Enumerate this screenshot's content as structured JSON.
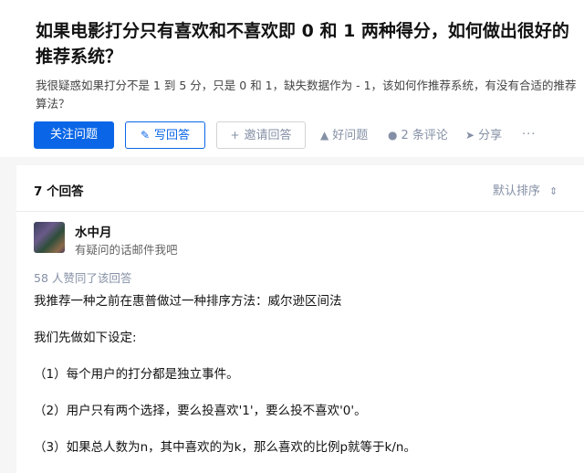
{
  "question": {
    "title": "如果电影打分只有喜欢和不喜欢即 0 和 1 两种得分，如何做出很好的推荐系统？",
    "description": "我很疑惑如果打分不是 1 到 5 分，只是 0 和 1，缺失数据作为 - 1，该如何作推荐系统，有没有合适的推荐算法？"
  },
  "actions": {
    "follow_label": "关注问题",
    "write_label": "写回答",
    "invite_label": "邀请回答",
    "good_question_label": "好问题",
    "comments_label": "2 条评论",
    "share_label": "分享",
    "more_label": "···"
  },
  "answers": {
    "count_label": "7 个回答",
    "sort_label": "默认排序"
  },
  "answer": {
    "author_name": "水中月",
    "author_bio": "有疑问的话邮件我吧",
    "votes_label": "58 人赞同了该回答",
    "paragraphs": [
      "我推荐一种之前在惠普做过一种排序方法：威尔逊区间法",
      "我们先做如下设定:",
      "（1）每个用户的打分都是独立事件。",
      "（2）用户只有两个选择，要么投喜欢'1'，要么投不喜欢'0'。",
      "（3）如果总人数为n，其中喜欢的为k，那么喜欢的比例p就等于k/n。"
    ]
  },
  "colors": {
    "accent": "#0a66e6",
    "muted": "#8590a6",
    "background": "#f6f6f6"
  }
}
